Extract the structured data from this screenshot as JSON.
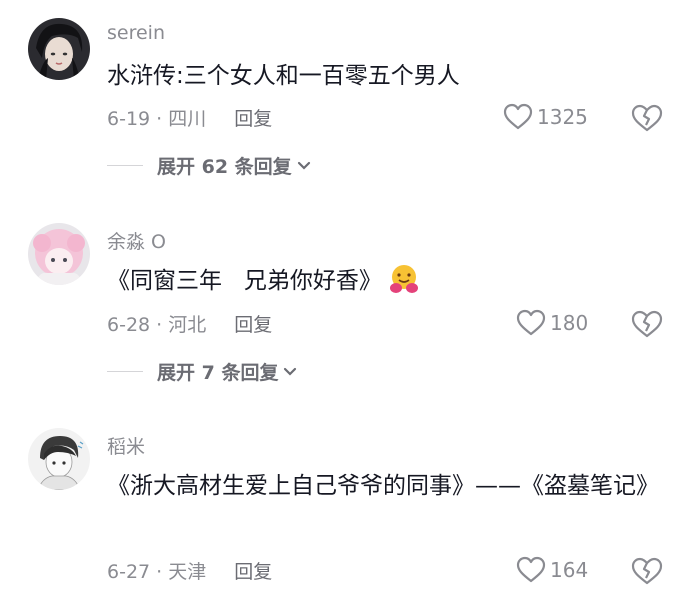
{
  "comments": [
    {
      "username": "serein",
      "text": "水浒传:三个女人和一百零五个男人",
      "date_location": "6-19 · 四川",
      "reply_label": "回复",
      "likes": "1325",
      "expand_label": "展开 62 条回复",
      "avatar_icon": "avatar-dark-hair-girl"
    },
    {
      "username": "余淼 O",
      "text": "《同窗三年   兄弟你好香》",
      "emoji": "hugging-face-emoji",
      "date_location": "6-28 · 河北",
      "reply_label": "回复",
      "likes": "180",
      "expand_label": "展开 7 条回复",
      "avatar_icon": "avatar-pink-hair-anime"
    },
    {
      "username": "稻米",
      "text": "《浙大高材生爱上自己爷爷的同事》——《盗墓笔记》",
      "date_location": "6-27 · 天津",
      "reply_label": "回复",
      "likes": "164",
      "avatar_icon": "avatar-sketch-boy"
    }
  ],
  "colors": {
    "secondary_text": "#8a8b91",
    "primary_text": "#161823"
  }
}
